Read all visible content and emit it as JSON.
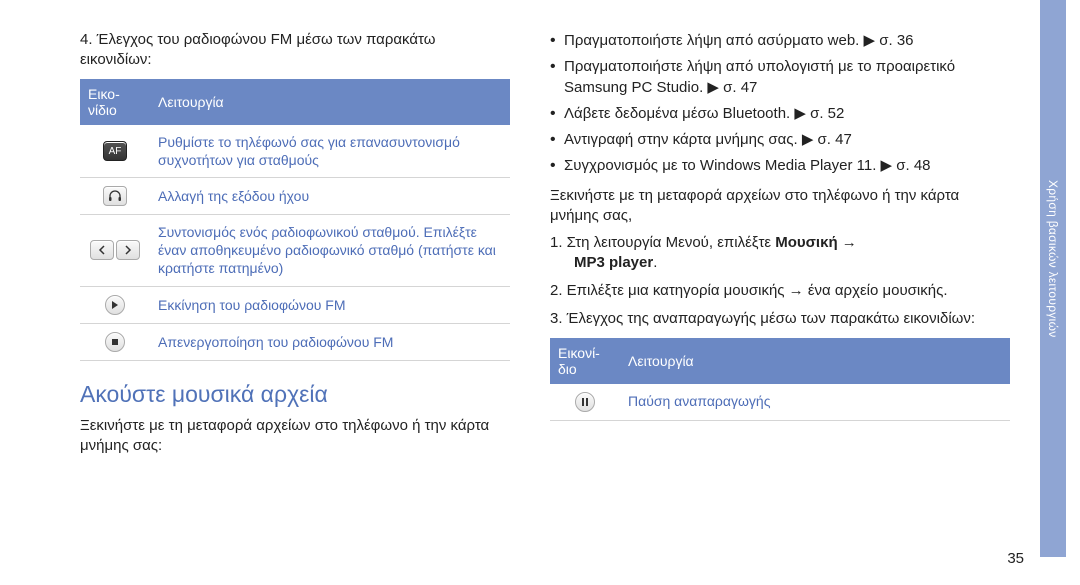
{
  "left": {
    "step4": "4. Έλεγχος του ραδιοφώνου FM μέσω των παρακάτω εικονιδίων:",
    "table_head_icon": "Εικο-\nνίδιο",
    "table_head_func": "Λειτουργία",
    "rows": [
      {
        "icon": "AF",
        "text": "Ρυθμίστε το τηλέφωνό σας για επανασυντονισμό συχνοτήτων για σταθμούς"
      },
      {
        "icon": "hp",
        "text": "Αλλαγή της εξόδου ήχου"
      },
      {
        "icon": "lr",
        "text": "Συντονισμός ενός ραδιοφωνικού σταθμού. Επιλέξτε έναν αποθηκευμένο ραδιοφωνικό σταθμό (πατήστε και κρατήστε πατημένο)"
      },
      {
        "icon": "play",
        "text": "Εκκίνηση του ραδιοφώνου FM"
      },
      {
        "icon": "stop",
        "text": "Απενεργοποίηση του ραδιοφώνου FM"
      }
    ],
    "heading": "Ακούστε μουσικά αρχεία",
    "intro": "Ξεκινήστε με τη μεταφορά αρχείων στο τηλέφωνο ή την κάρτα μνήμης σας:"
  },
  "right": {
    "bullets": [
      "Πραγματοποιήστε λήψη από ασύρματο web. ▶ σ. 36",
      "Πραγματοποιήστε λήψη από υπολογιστή με το προαιρετικό Samsung PC Studio. ▶ σ. 47",
      "Λάβετε δεδομένα μέσω Bluetooth. ▶ σ. 52",
      "Αντιγραφή στην κάρτα μνήμης σας. ▶ σ. 47",
      "Συγχρονισμός με το Windows Media Player 11. ▶ σ. 48"
    ],
    "intro2": "Ξεκινήστε με τη μεταφορά αρχείων στο τηλέφωνο ή την κάρτα μνήμης σας,",
    "step1a": "1. Στη λειτουργία Μενού, επιλέξτε ",
    "step1b_bold": "Μουσική",
    "step1c": " → ",
    "step1d_bold": "MP3 player",
    "step1e": ".",
    "step2": "2. Επιλέξτε μια κατηγορία μουσικής → ένα αρχείο μουσικής.",
    "step3": "3. Έλεγχος της αναπαραγωγής μέσω των παρακάτω εικονιδίων:",
    "table2_head_icon": "Εικονί-\nδιο",
    "table2_head_func": "Λειτουργία",
    "table2_row1": "Παύση αναπαραγωγής"
  },
  "side_tab": "Χρήση βασικών λειτουργιών",
  "page_number": "35"
}
